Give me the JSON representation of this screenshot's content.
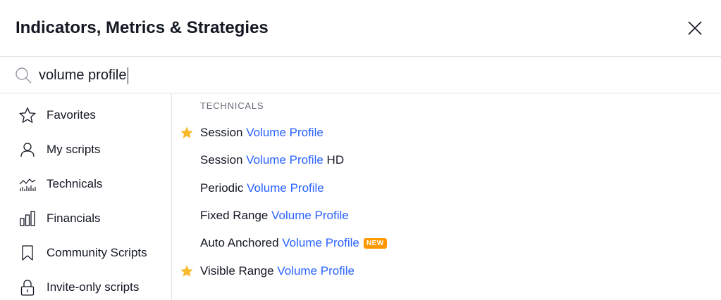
{
  "dialog": {
    "title": "Indicators, Metrics & Strategies"
  },
  "search": {
    "value": "volume profile"
  },
  "sidebar": {
    "items": [
      {
        "label": "Favorites",
        "icon": "star-outline-icon"
      },
      {
        "label": "My scripts",
        "icon": "user-icon"
      },
      {
        "label": "Technicals",
        "icon": "technicals-chart-icon"
      },
      {
        "label": "Financials",
        "icon": "bar-chart-icon"
      },
      {
        "label": "Community Scripts",
        "icon": "bookmark-icon"
      },
      {
        "label": "Invite-only scripts",
        "icon": "lock-icon"
      }
    ]
  },
  "results": {
    "section_title": "TECHNICALS",
    "items": [
      {
        "prefix": "Session ",
        "match": "Volume Profile",
        "suffix": "",
        "favorite": true,
        "badge": ""
      },
      {
        "prefix": "Session ",
        "match": "Volume Profile",
        "suffix": " HD",
        "favorite": false,
        "badge": ""
      },
      {
        "prefix": "Periodic ",
        "match": "Volume Profile",
        "suffix": "",
        "favorite": false,
        "badge": ""
      },
      {
        "prefix": "Fixed Range ",
        "match": "Volume Profile",
        "suffix": "",
        "favorite": false,
        "badge": ""
      },
      {
        "prefix": "Auto Anchored ",
        "match": "Volume Profile",
        "suffix": "",
        "favorite": false,
        "badge": "NEW"
      },
      {
        "prefix": "Visible Range ",
        "match": "Volume Profile",
        "suffix": "",
        "favorite": true,
        "badge": ""
      }
    ]
  },
  "colors": {
    "accent": "#2962ff",
    "favorite_star": "#f7b928",
    "badge_bg": "#ff9800",
    "border": "#e0e3eb",
    "text": "#131722",
    "muted": "#6a6d78"
  }
}
